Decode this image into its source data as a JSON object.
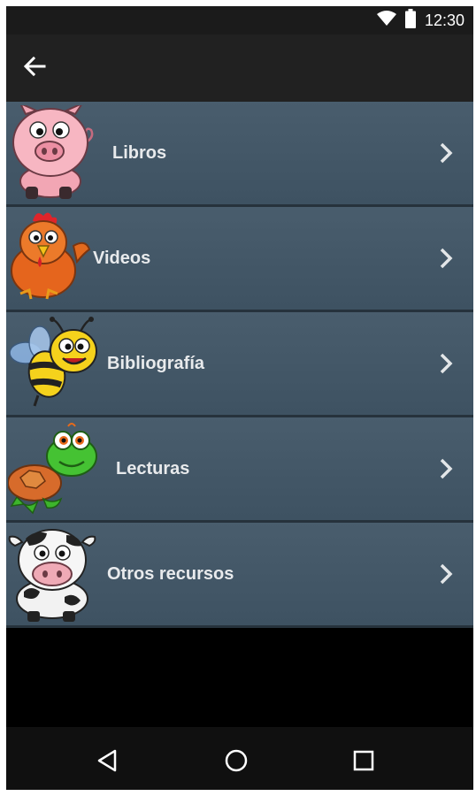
{
  "status_bar": {
    "time": "12:30",
    "icons": [
      "wifi-icon",
      "battery-icon"
    ]
  },
  "app_bar": {
    "back_icon": "arrow-back-icon"
  },
  "menu": {
    "items": [
      {
        "label": "Libros",
        "icon": "pig-icon"
      },
      {
        "label": "Videos",
        "icon": "chicken-icon"
      },
      {
        "label": "Bibliografía",
        "icon": "bee-icon"
      },
      {
        "label": "Lecturas",
        "icon": "turtle-icon"
      },
      {
        "label": "Otros recursos",
        "icon": "cow-icon"
      }
    ],
    "chevron_icon": "chevron-right-icon"
  },
  "nav_bar": {
    "icons": [
      "back-triangle-icon",
      "home-circle-icon",
      "recents-square-icon"
    ]
  },
  "colors": {
    "item_bg": "#495d6d",
    "app_bar_bg": "#212121",
    "status_bar_bg": "#1b1b1b",
    "label": "#e8eaec"
  }
}
